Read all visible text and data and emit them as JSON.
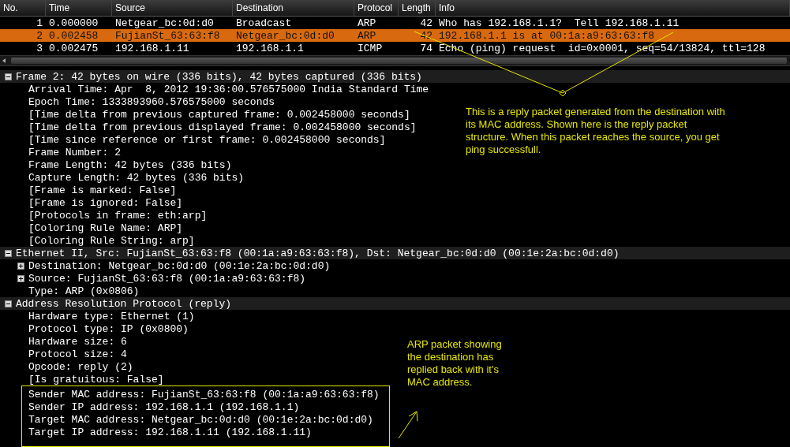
{
  "packet_list": {
    "columns": [
      "No.",
      "Time",
      "Source",
      "Destination",
      "Protocol",
      "Length",
      "Info"
    ],
    "rows": [
      {
        "cells": [
          "1",
          "0.000000",
          "Netgear_bc:0d:d0",
          "Broadcast",
          "ARP",
          "42",
          "Who has 192.168.1.1?  Tell 192.168.1.11"
        ],
        "selected": false
      },
      {
        "cells": [
          "2",
          "0.002458",
          "FujianSt_63:63:f8",
          "Netgear_bc:0d:d0",
          "ARP",
          "42",
          "192.168.1.1 is at 00:1a:a9:63:63:f8"
        ],
        "selected": true
      },
      {
        "cells": [
          "3",
          "0.002475",
          "192.168.1.11",
          "192.168.1.1",
          "ICMP",
          "74",
          "Echo (ping) request  id=0x0001, seq=54/13824, ttl=128"
        ],
        "selected": false
      }
    ]
  },
  "details": [
    {
      "text": "Frame 2: 42 bytes on wire (336 bits), 42 bytes captured (336 bits)",
      "expanded": true,
      "children": [
        {
          "text": "Arrival Time: Apr  8, 2012 19:36:00.576575000 India Standard Time"
        },
        {
          "text": "Epoch Time: 1333893960.576575000 seconds"
        },
        {
          "text": "[Time delta from previous captured frame: 0.002458000 seconds]"
        },
        {
          "text": "[Time delta from previous displayed frame: 0.002458000 seconds]"
        },
        {
          "text": "[Time since reference or first frame: 0.002458000 seconds]"
        },
        {
          "text": "Frame Number: 2"
        },
        {
          "text": "Frame Length: 42 bytes (336 bits)"
        },
        {
          "text": "Capture Length: 42 bytes (336 bits)"
        },
        {
          "text": "[Frame is marked: False]"
        },
        {
          "text": "[Frame is ignored: False]"
        },
        {
          "text": "[Protocols in frame: eth:arp]"
        },
        {
          "text": "[Coloring Rule Name: ARP]"
        },
        {
          "text": "[Coloring Rule String: arp]"
        }
      ]
    },
    {
      "text": "Ethernet II, Src: FujianSt_63:63:f8 (00:1a:a9:63:63:f8), Dst: Netgear_bc:0d:d0 (00:1e:2a:bc:0d:d0)",
      "expanded": true,
      "children": [
        {
          "text": "Destination: Netgear_bc:0d:d0 (00:1e:2a:bc:0d:d0)",
          "expanded": false
        },
        {
          "text": "Source: FujianSt_63:63:f8 (00:1a:a9:63:63:f8)",
          "expanded": false
        },
        {
          "text": "Type: ARP (0x0806)"
        }
      ]
    },
    {
      "text": "Address Resolution Protocol (reply)",
      "expanded": true,
      "children": [
        {
          "text": "Hardware type: Ethernet (1)",
          "boxed": false
        },
        {
          "text": "Protocol type: IP (0x0800)",
          "boxed": false
        },
        {
          "text": "Hardware size: 6",
          "boxed": false
        },
        {
          "text": "Protocol size: 4",
          "boxed": false
        },
        {
          "text": "Opcode: reply (2)",
          "boxed": false
        },
        {
          "text": "[Is gratuitous: False]",
          "boxed": false
        },
        {
          "text": "Sender MAC address: FujianSt_63:63:f8 (00:1a:a9:63:63:f8)",
          "boxed": true
        },
        {
          "text": "Sender IP address: 192.168.1.1 (192.168.1.1)",
          "boxed": true
        },
        {
          "text": "Target MAC address: Netgear_bc:0d:d0 (00:1e:2a:bc:0d:d0)",
          "boxed": true
        },
        {
          "text": "Target IP address: 192.168.1.11 (192.168.1.11)",
          "boxed": true
        }
      ]
    }
  ],
  "annotations": [
    {
      "text": "This is a reply packet generated from the destination with its MAC address. Shown here is the reply packet structure. When this packet reaches the source, you get ping successfull."
    },
    {
      "text": "ARP packet showing the destination has replied back with it's MAC address."
    }
  ]
}
